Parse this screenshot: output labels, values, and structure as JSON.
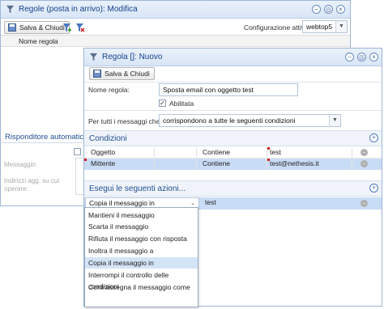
{
  "back_window": {
    "title": "Regole (posta in arrivo): Modifica",
    "save_close": "Salva & Chiudi",
    "config_label": "Configurazione attiva:",
    "config_value": "webtop5",
    "col_header": "Nome regola",
    "side_section": "Risponditore automatico",
    "messaggio_label": "Messaggio:",
    "indirizzi_label": "Indirizzi agg. su cui operare:"
  },
  "front_window": {
    "title": "Regola []: Nuovo",
    "save_close": "Salva & Chiudi",
    "name_label": "Nome regola:",
    "name_value": "Sposta email con oggetto test",
    "enabled_label": "Abilitata",
    "for_all_label": "Per tutti i messaggi che:",
    "for_all_value": "corrispondono a tutte le seguenti condizioni",
    "conditions_title": "Condizioni",
    "conditions": [
      {
        "field": "Oggetto",
        "op": "Contiene",
        "value": "test"
      },
      {
        "field": "Mittente",
        "op": "Contiene",
        "value": "test@nethesis.it"
      }
    ],
    "actions_title": "Esegui le seguenti azioni...",
    "action_selected": "Copia il messaggio in",
    "action_value": "test",
    "dropdown_options": [
      "Mantieni il messaggio",
      "Scarta il messaggio",
      "Rifiuta il messaggio con risposta",
      "Inoltra il messaggio a",
      "Copia il messaggio in",
      "Interrompi il controllo delle condizioni",
      "Contrassegna il messaggio come"
    ],
    "dropdown_highlight_index": 4
  },
  "colors": {
    "title_text": "#15428b",
    "selected_row": "#c9dcf5",
    "highlight_item": "#d4e4f7",
    "accent": "#4a78c0"
  }
}
